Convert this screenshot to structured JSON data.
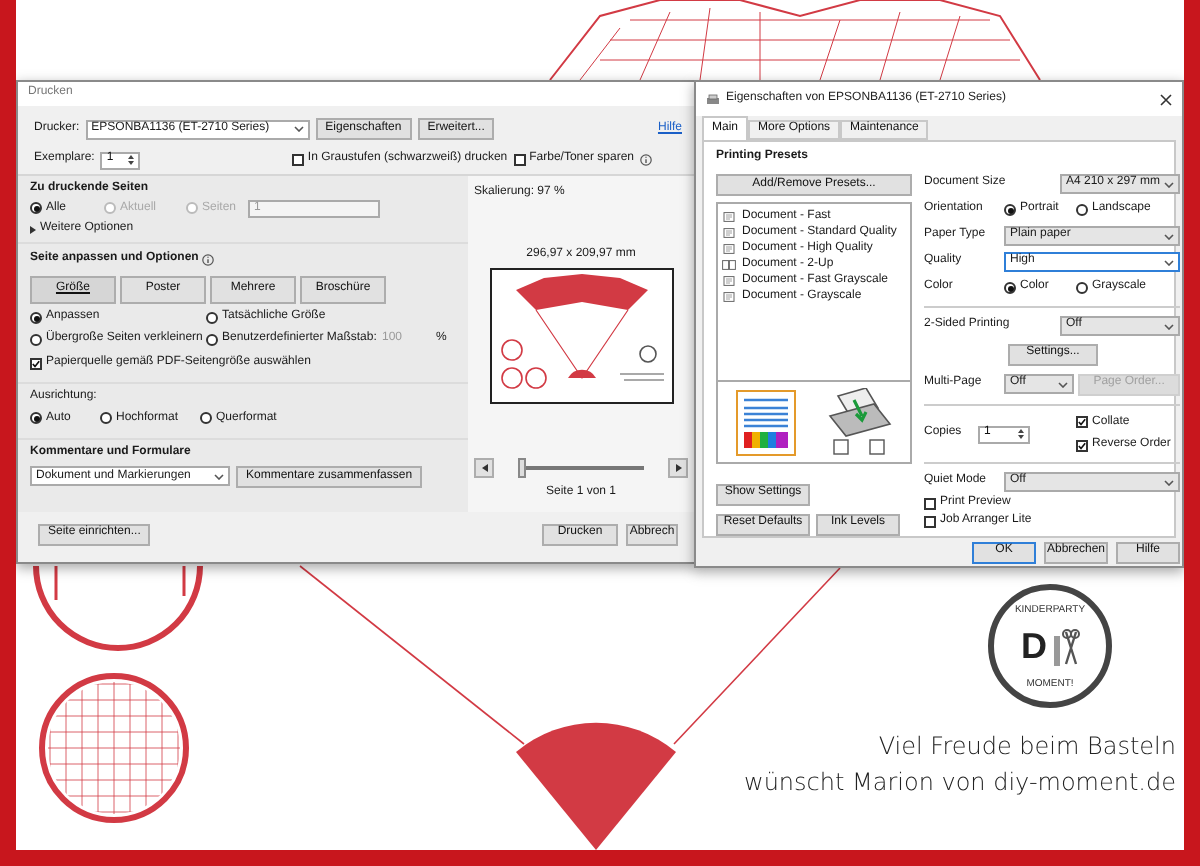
{
  "print_dialog": {
    "title": "Drucken",
    "printer_label": "Drucker:",
    "printer": "EPSONBA1136 (ET-2710 Series)",
    "printer_buttons": [
      "Eigenschaften",
      "Erweitert..."
    ],
    "help_link": "Hilfe",
    "copies_label": "Exemplare:",
    "copies": "1",
    "print_options": [
      {
        "label": "In Graustufen (schwarzweiß) drucken",
        "checked": false
      },
      {
        "label": "Farbe/Toner sparen",
        "checked": false
      }
    ],
    "pages": {
      "title": "Zu druckende Seiten",
      "radios": [
        {
          "label": "Alle",
          "selected": true,
          "disabled": false
        },
        {
          "label": "Aktuell",
          "selected": false,
          "disabled": true
        },
        {
          "label": "Seiten",
          "selected": false,
          "disabled": true
        }
      ],
      "range": "1",
      "more": "Weitere Optionen"
    },
    "fit": {
      "title": "Seite anpassen und Optionen",
      "tabs": [
        {
          "label": "Größe",
          "selected": true
        },
        {
          "label": "Poster",
          "selected": false
        },
        {
          "label": "Mehrere",
          "selected": false
        },
        {
          "label": "Broschüre",
          "selected": false
        }
      ],
      "radios": [
        {
          "label": "Anpassen",
          "selected": true
        },
        {
          "label": "Tatsächliche Größe",
          "selected": false
        },
        {
          "label": "Übergroße Seiten verkleinern",
          "selected": false
        },
        {
          "label": "Benutzerdefinierter Maßstab:",
          "selected": false
        }
      ],
      "scale": "100",
      "scale_unit": "%",
      "paper_source": {
        "label": "Papierquelle gemäß PDF-Seitengröße auswählen",
        "checked": true
      }
    },
    "orientation": {
      "title": "Ausrichtung:",
      "radios": [
        {
          "label": "Auto",
          "selected": true
        },
        {
          "label": "Hochformat",
          "selected": false
        },
        {
          "label": "Querformat",
          "selected": false
        }
      ]
    },
    "comments": {
      "title": "Kommentare und Formulare",
      "value": "Dokument und Markierungen",
      "button": "Kommentare zusammenfassen"
    },
    "preview": {
      "scaling": "Skalierung: 97 %",
      "size": "296,97 x 209,97 mm",
      "page": "Seite 1 von 1",
      "level": 0
    },
    "footer": {
      "setup": "Seite einrichten...",
      "buttons": [
        "Drucken",
        "Abbrech"
      ]
    }
  },
  "properties_dialog": {
    "title": "Eigenschaften von EPSONBA1136 (ET-2710 Series)",
    "tabs": [
      {
        "label": "Main",
        "selected": true
      },
      {
        "label": "More Options",
        "selected": false
      },
      {
        "label": "Maintenance",
        "selected": false
      }
    ],
    "presets_title": "Printing Presets",
    "add_button": "Add/Remove Presets...",
    "presets": [
      {
        "label": "Document - Fast",
        "kind": "document"
      },
      {
        "label": "Document - Standard Quality",
        "kind": "document"
      },
      {
        "label": "Document - High Quality",
        "kind": "document"
      },
      {
        "label": "Document - 2-Up",
        "kind": "twoup"
      },
      {
        "label": "Document - Fast Grayscale",
        "kind": "document"
      },
      {
        "label": "Document - Grayscale",
        "kind": "document"
      }
    ],
    "left_buttons": [
      "Show Settings",
      "Reset Defaults",
      "Ink Levels"
    ],
    "groups": [
      {
        "rows": [
          {
            "kind": "select",
            "label": "Document Size",
            "value": "A4 210 x 297 mm",
            "focused": false
          },
          {
            "kind": "radio",
            "label": "Orientation",
            "options": [
              {
                "label": "Portrait",
                "selected": true
              },
              {
                "label": "Landscape",
                "selected": false
              }
            ]
          },
          {
            "kind": "select",
            "label": "Paper Type",
            "value": "Plain paper",
            "focused": false
          },
          {
            "kind": "select",
            "label": "Quality",
            "value": "High",
            "focused": true
          },
          {
            "kind": "radio",
            "label": "Color",
            "options": [
              {
                "label": "Color",
                "selected": true
              },
              {
                "label": "Grayscale",
                "selected": false
              }
            ]
          }
        ]
      },
      {
        "rows": [
          {
            "kind": "select",
            "label": "2-Sided Printing",
            "value": "Off",
            "focused": false
          },
          {
            "kind": "button",
            "label": "Settings...",
            "disabled": false
          },
          {
            "kind": "select_button",
            "label": "Multi-Page",
            "value": "Off",
            "focused": false,
            "button": {
              "label": "Page Order...",
              "disabled": true
            }
          }
        ]
      },
      {
        "rows": [
          {
            "kind": "copies",
            "label": "Copies",
            "value": "1",
            "checks": [
              {
                "label": "Collate",
                "checked": true
              },
              {
                "label": "Reverse Order",
                "checked": true
              }
            ]
          }
        ]
      },
      {
        "rows": [
          {
            "kind": "select",
            "label": "Quiet Mode",
            "value": "Off",
            "focused": false
          },
          {
            "kind": "check",
            "label": "Print Preview",
            "checked": false
          },
          {
            "kind": "check",
            "label": "Job Arranger Lite",
            "checked": false
          }
        ]
      }
    ],
    "footer_buttons": [
      "OK",
      "Abbrechen",
      "Hilfe"
    ]
  },
  "logo": {
    "top": "KINDERPARTY",
    "letter": "D",
    "bottom": "MOMENT!"
  },
  "greeting": [
    "Viel Freude beim Basteln",
    "wünscht Marion von diy-moment.de"
  ]
}
